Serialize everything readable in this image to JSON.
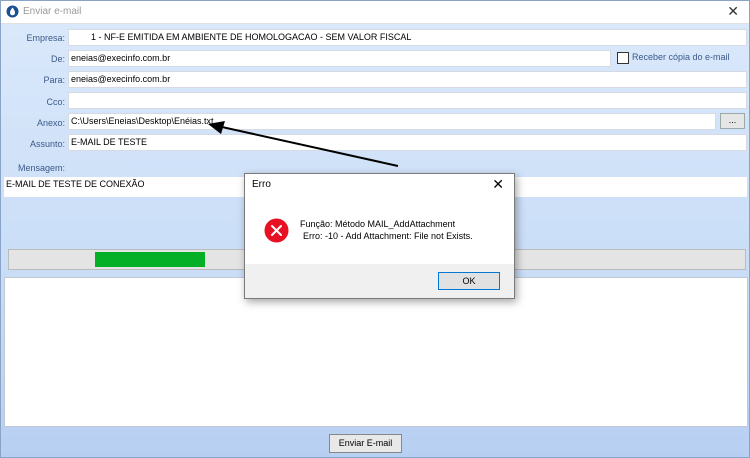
{
  "window": {
    "title": "Enviar e-mail",
    "close_glyph": "✕",
    "app_icon": "drop-icon"
  },
  "form": {
    "empresa": {
      "label": "Empresa:",
      "value": "1 - NF-E EMITIDA EM AMBIENTE DE HOMOLOGACAO - SEM VALOR FISCAL"
    },
    "de": {
      "label": "De:",
      "value": "eneias@execinfo.com.br"
    },
    "receber_copia": {
      "label": "Receber cópia do e-mail",
      "checked": false
    },
    "para": {
      "label": "Para:",
      "value": "eneias@execinfo.com.br"
    },
    "cco": {
      "label": "Cco:",
      "value": ""
    },
    "anexo": {
      "label": "Anexo:",
      "value": "C:\\Users\\Eneias\\Desktop\\Enéias.txt,",
      "browse_label": "..."
    },
    "assunto": {
      "label": "Assunto:",
      "value": "E-MAIL DE TESTE"
    },
    "mensagem": {
      "label": "Mensagem:",
      "value": "E-MAIL DE TESTE DE CONEXÃO"
    }
  },
  "progress": {
    "fraction": 0.15,
    "color": "#06b026"
  },
  "send_button": {
    "label": "Enviar E-mail"
  },
  "dialog": {
    "title": "Erro",
    "close_glyph": "✕",
    "icon": "error-icon",
    "line1": "Função: Método MAIL_AddAttachment",
    "line2": "Erro:  -10 - Add Attachment: File not Exists.",
    "ok_label": "OK"
  },
  "colors": {
    "error_red": "#e81123",
    "accent_blue": "#0078d7"
  }
}
